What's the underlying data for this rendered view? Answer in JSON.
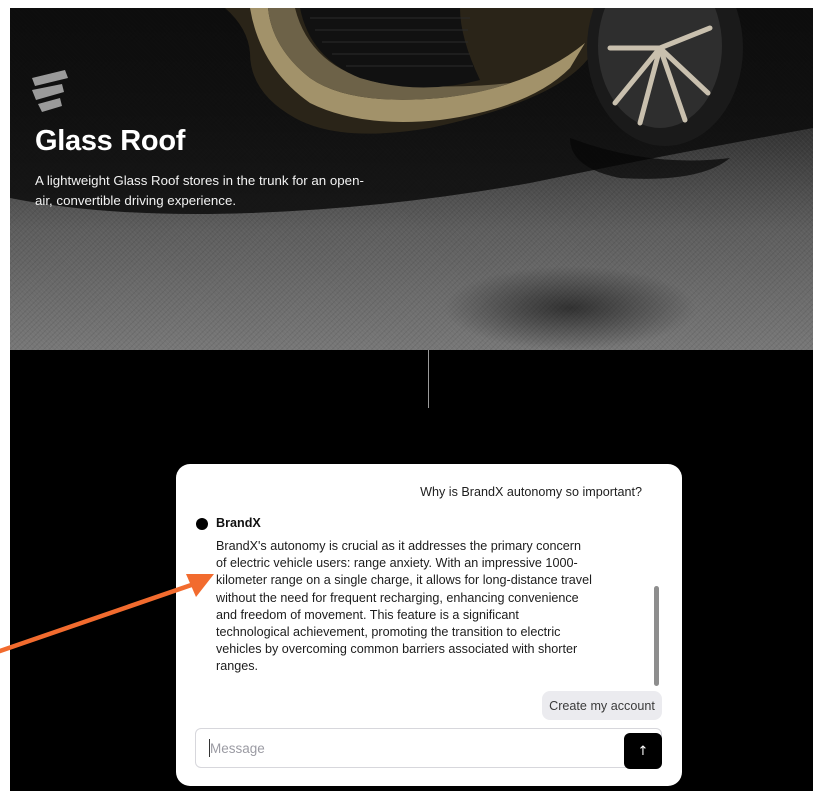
{
  "hero": {
    "title": "Glass Roof",
    "subtitle": "A lightweight Glass Roof stores in the trunk for an open-air, convertible driving experience."
  },
  "chat": {
    "user_question": "Why is BrandX autonomy so important?",
    "bot_name": "BrandX",
    "bot_message": "BrandX's autonomy is crucial as it addresses the primary concern of electric vehicle users: range anxiety. With an impressive 1000-kilometer range on a single charge, it allows for long-distance travel without the need for frequent recharging, enhancing convenience and freedom of movement. This feature is a significant technological achievement, promoting the transition to electric vehicles by overcoming common barriers associated with shorter ranges.",
    "create_account_label": "Create my account",
    "input_placeholder": "Message",
    "send_icon": "arrow-up-icon"
  },
  "colors": {
    "page_background": "#000000",
    "panel_background": "#ffffff",
    "send_button": "#000000",
    "annotation_arrow": "#f26b2e"
  }
}
